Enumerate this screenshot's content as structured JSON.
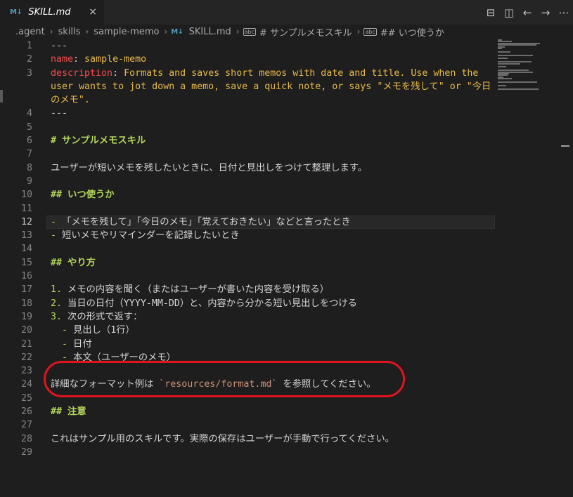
{
  "tab": {
    "icon": "M↓",
    "title": "SKILL.md",
    "close": "×"
  },
  "actions": [
    "split-compare-icon",
    "split-editor-icon",
    "arrow-left-icon",
    "arrow-right-icon",
    "more-icon"
  ],
  "breadcrumb": {
    "items": [
      ".agent",
      "skills",
      "sample-memo",
      "SKILL.md",
      "# サンプルメモスキル",
      "## いつ使うか"
    ],
    "file_icon": "M↓",
    "symbol_icon": "abc"
  },
  "lines": [
    {
      "n": "1",
      "text": "---"
    },
    {
      "n": "2",
      "key": "name",
      "val": " sample-memo"
    },
    {
      "n": "3",
      "key": "description",
      "val": " Formats and saves short memos with date and title. Use when the"
    },
    {
      "n": "",
      "val": "user wants to jot down a memo, save a quick note, or says \"メモを残して\" or \"今日"
    },
    {
      "n": "",
      "val": "のメモ\"."
    },
    {
      "n": "4",
      "text": "---"
    },
    {
      "n": "5",
      "text": ""
    },
    {
      "n": "6",
      "head": "# サンプルメモスキル"
    },
    {
      "n": "7",
      "text": ""
    },
    {
      "n": "8",
      "text": "ユーザーが短いメモを残したいときに、日付と見出しをつけて整理します。"
    },
    {
      "n": "9",
      "text": ""
    },
    {
      "n": "10",
      "head": "## いつ使うか"
    },
    {
      "n": "11",
      "text": ""
    },
    {
      "n": "12",
      "bullet": "-",
      "text": " 「メモを残して」「今日のメモ」「覚えておきたい」などと言ったとき",
      "active": true
    },
    {
      "n": "13",
      "bullet": "-",
      "text": " 短いメモやリマインダーを記録したいとき"
    },
    {
      "n": "14",
      "text": ""
    },
    {
      "n": "15",
      "head": "## やり方"
    },
    {
      "n": "16",
      "text": ""
    },
    {
      "n": "17",
      "bullet": "1.",
      "text": " メモの内容を聞く（またはユーザーが書いた内容を受け取る）"
    },
    {
      "n": "18",
      "bullet": "2.",
      "text": " 当日の日付（YYYY-MM-DD）と、内容から分かる短い見出しをつける"
    },
    {
      "n": "19",
      "bullet": "3.",
      "text": " 次の形式で返す："
    },
    {
      "n": "20",
      "indent": true,
      "bullet": "-",
      "text": " 見出し（1行）"
    },
    {
      "n": "21",
      "indent": true,
      "bullet": "-",
      "text": " 日付"
    },
    {
      "n": "22",
      "indent": true,
      "bullet": "-",
      "text": " 本文（ユーザーのメモ）"
    },
    {
      "n": "23",
      "text": ""
    },
    {
      "n": "24",
      "text": "詳細なフォーマット例は ",
      "code": "`resources/format.md`",
      "after": " を参照してください。"
    },
    {
      "n": "25",
      "text": ""
    },
    {
      "n": "26",
      "head": "## 注意"
    },
    {
      "n": "27",
      "text": ""
    },
    {
      "n": "28",
      "text": "これはサンプル用のスキルです。実際の保存はユーザーが手動で行ってください。"
    },
    {
      "n": "29",
      "text": ""
    }
  ],
  "colors": {
    "highlight_ellipse": "#e0141e",
    "heading": "#b5d75a",
    "yaml_key": "#f14c4c",
    "yaml_value": "#e8b949"
  }
}
